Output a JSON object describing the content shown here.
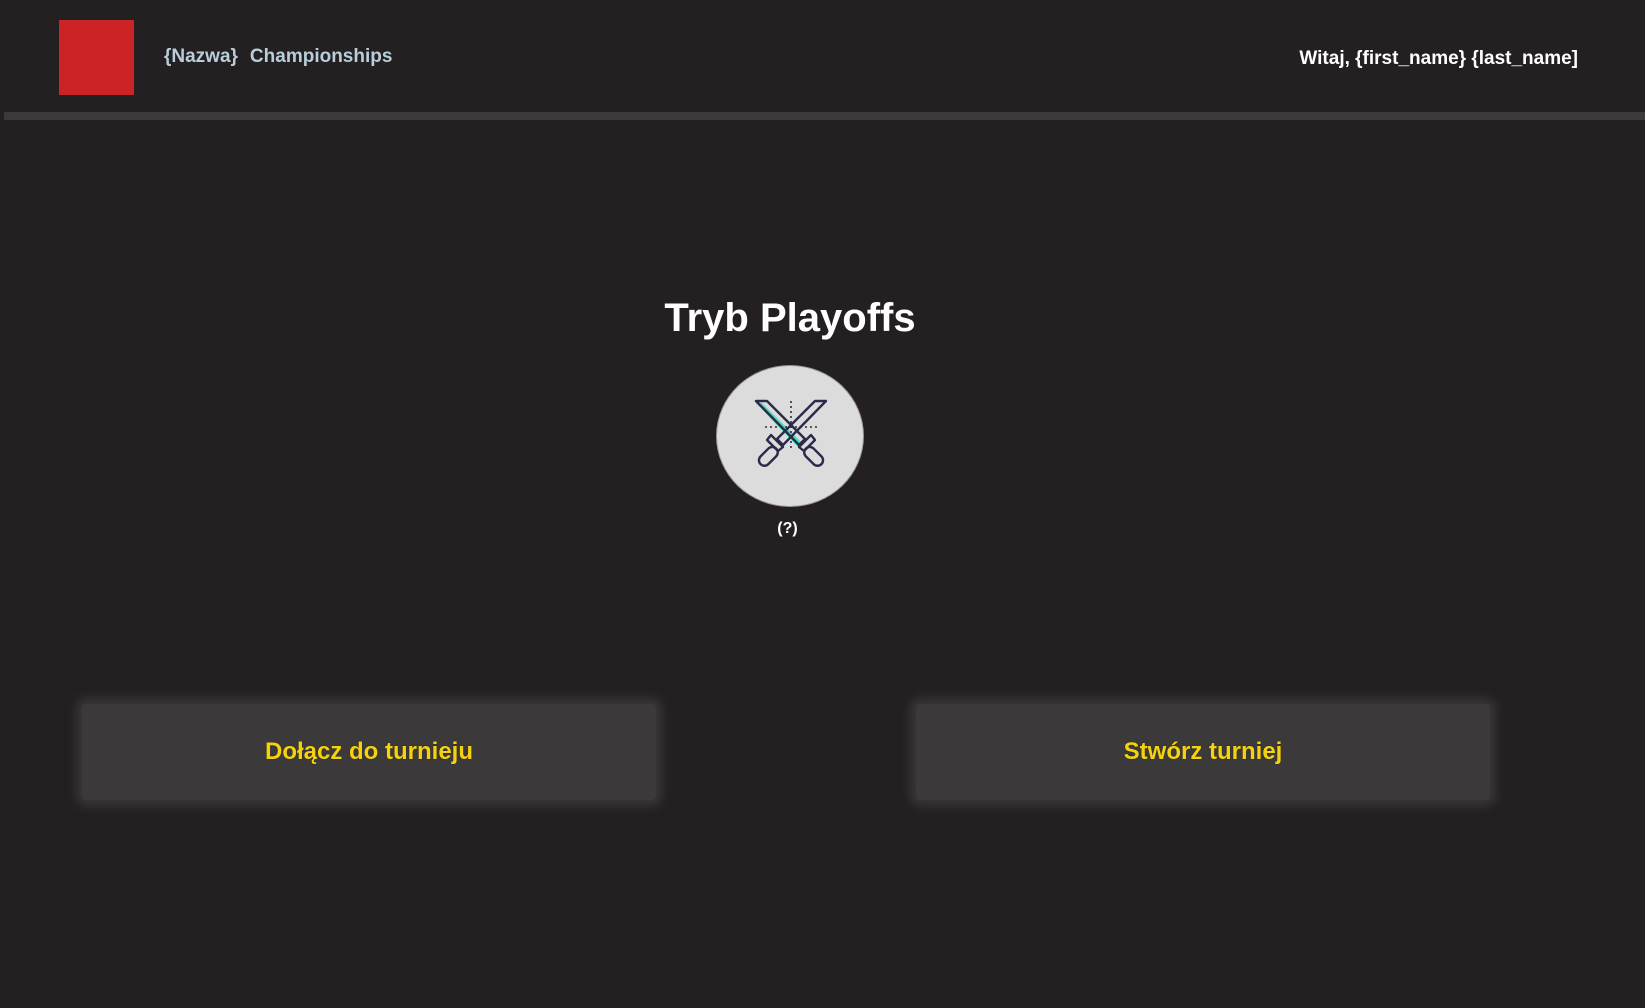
{
  "header": {
    "brand_name": "{Nazwa}",
    "brand_suffix": "Championships",
    "greeting": "Witaj, {first_name} {last_name]",
    "logo_color": "#cc2327"
  },
  "main": {
    "title": "Tryb Playoffs",
    "mode_icon": "crossed-swords-icon",
    "help_text": "(?)"
  },
  "actions": {
    "join_label": "Dołącz do turnieju",
    "create_label": "Stwórz turniej"
  },
  "colors": {
    "background": "#242022",
    "accent_text": "#f5d20f",
    "brand_text": "#b8cedb",
    "sword_accent": "#3fe3b8"
  }
}
